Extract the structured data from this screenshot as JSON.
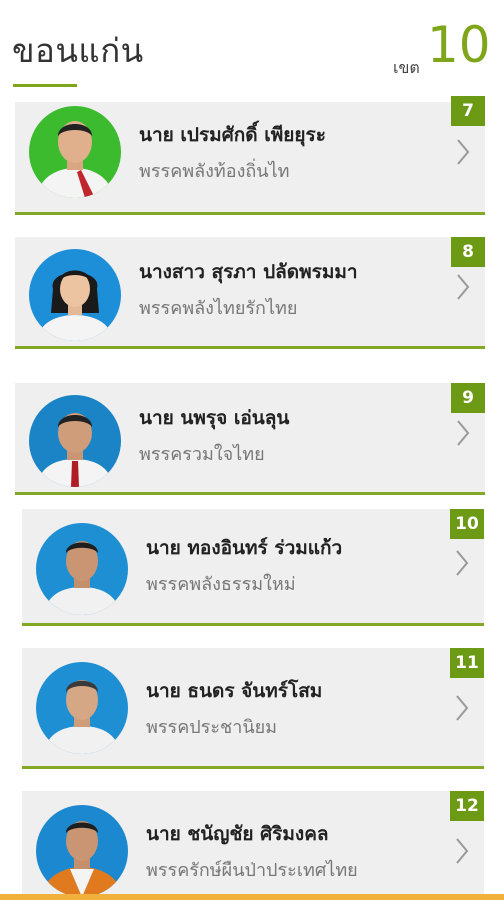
{
  "header": {
    "province": "ขอนแก่น",
    "district_label": "เขต",
    "district_number": "10"
  },
  "candidates": [
    {
      "number": "7",
      "name": "นาย เปรมศักดิ์ เพียยุระ",
      "party": "พรรคพลังท้องถิ่นไท",
      "photo_background": "#3dbb2f",
      "avatar_icon": "person-photo"
    },
    {
      "number": "8",
      "name": "นางสาว สุรภา ปลัดพรมมา",
      "party": "พรรคพลังไทยรักไทย",
      "photo_background": "#1c8fd8",
      "avatar_icon": "person-photo"
    },
    {
      "number": "9",
      "name": "นาย นพรุจ เอ่นลุน",
      "party": "พรรครวมใจไทย",
      "photo_background": "#1a84c6",
      "avatar_icon": "person-photo"
    },
    {
      "number": "10",
      "name": "นาย ทองอินทร์ ร่วมแก้ว",
      "party": "พรรคพลังธรรมใหม่",
      "photo_background": "#1f8fd4",
      "avatar_icon": "person-photo"
    },
    {
      "number": "11",
      "name": "นาย ธนดร จันทร์โสม",
      "party": "พรรคประชานิยม",
      "photo_background": "#1f8fd4",
      "avatar_icon": "person-photo"
    },
    {
      "number": "12",
      "name": "นาย ชนัญชัย ศิริมงคล",
      "party": "พรรครักษ์ผืนป่าประเทศไทย",
      "photo_background": "#1c88cf",
      "avatar_icon": "person-photo"
    }
  ],
  "colors": {
    "accent": "#7fa61a",
    "badge": "#6d9a14",
    "card_background": "#efefef",
    "bottom_bar": "#f0b23c"
  }
}
